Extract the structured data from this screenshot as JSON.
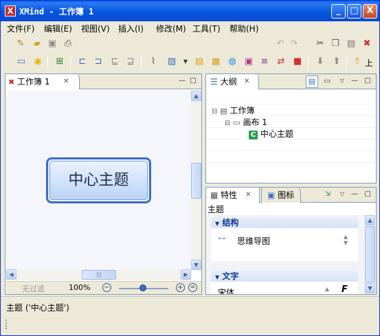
{
  "window": {
    "title": "XMind - 工作簿 1",
    "logo_text": "X",
    "minimize": "_",
    "maximize": "□",
    "close": "X"
  },
  "menu": {
    "items": [
      "文件(F)",
      "编辑(E)",
      "视图(V)",
      "插入(I)",
      "修改(M)",
      "工具(T)",
      "帮助(H)"
    ]
  },
  "toolbar": {
    "up_label": "上"
  },
  "editor": {
    "tab_label": "工作簿 1",
    "tab_close": "✕",
    "central_topic": "中心主题",
    "filter_label": "无过滤",
    "zoom": "100%",
    "zoom_out": "−",
    "zoom_in": "+",
    "zoom_fit": "=",
    "hscroll_grip": "|||",
    "min": "—",
    "max": "□"
  },
  "outline": {
    "tab_label": "大纲",
    "tab_close": "✕",
    "tree": [
      {
        "label": "工作簿",
        "toggle": "⊟"
      },
      {
        "label": "画布 1",
        "toggle": "⊟"
      },
      {
        "label": "中心主题",
        "icon": "C"
      }
    ]
  },
  "properties": {
    "tab_label": "特性",
    "tab_close": "✕",
    "icons_tab_label": "图标",
    "subject": "主题",
    "section_structure": "结构",
    "structure_value": "思维导图",
    "section_text": "文字",
    "font_value": "宋体",
    "font_icon": "F",
    "toggle": "▼"
  },
  "status": {
    "text": "主题 ('中心主题')"
  },
  "colors": {
    "accent": "#0a5fe8",
    "topic_border": "#3a6fc2",
    "topic_fill": "#cfe0fb",
    "close_red": "#c5461d"
  }
}
